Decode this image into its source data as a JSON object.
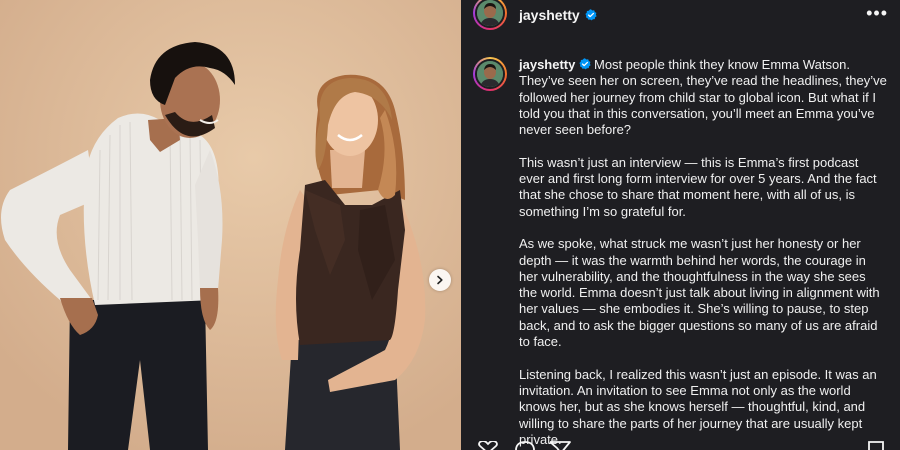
{
  "post": {
    "username": "jayshetty",
    "verified": true,
    "caption_intro": "Most people think they know Emma Watson. They’ve seen her on screen, they’ve read the headlines, they’ve followed her journey from child star to global icon. But what if I told you that in this conversation, you’ll meet an Emma you’ve never seen before?",
    "paragraphs": [
      "This wasn’t just an interview — this is Emma’s first podcast ever and first long form interview for over 5 years. And the fact that she chose to share that moment here, with all of us, is something I’m so grateful for.",
      "As we spoke, what struck me wasn’t just her honesty or her depth — it was the warmth behind her words, the courage in her vulnerability, and the thoughtfulness in the way she sees the world. Emma doesn’t just talk about living in alignment with her values — she embodies it. She’s willing to pause, to step back, and to ask the bigger questions so many of us are afraid to face.",
      "Listening back, I realized this wasn’t just an episode. It was an invitation. An invitation to see Emma not only as the world knows her, but as she knows herself — thoughtful, kind, and willing to share the parts of her journey that are usually kept private."
    ]
  },
  "icons": {
    "more": "more-options-icon",
    "next": "chevron-right-icon",
    "verified": "verified-badge-icon",
    "like": "heart-icon",
    "comment": "comment-icon",
    "share": "send-icon",
    "save": "bookmark-icon"
  },
  "colors": {
    "panel_bg": "#1e1e22",
    "verified_blue": "#0095f6",
    "photo_backdrop": "#dcb99a"
  }
}
